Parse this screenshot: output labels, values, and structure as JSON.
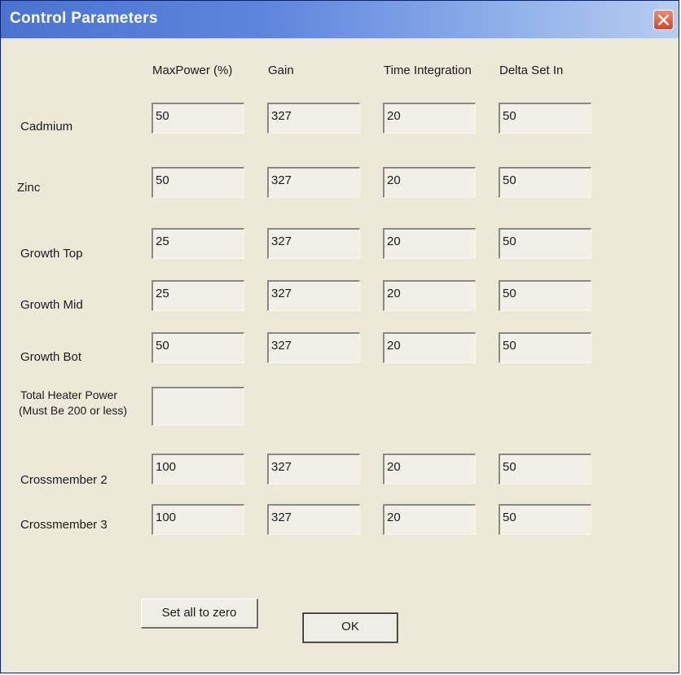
{
  "window": {
    "title": "Control Parameters"
  },
  "columns": [
    "MaxPower (%)",
    "Gain",
    "Time Integration",
    "Delta Set In"
  ],
  "rows": [
    {
      "label": "Cadmium",
      "values": [
        "50",
        "327",
        "20",
        "50"
      ]
    },
    {
      "label": "Zinc",
      "values": [
        "50",
        "327",
        "20",
        "50"
      ]
    },
    {
      "label": "Growth Top",
      "values": [
        "25",
        "327",
        "20",
        "50"
      ]
    },
    {
      "label": "Growth Mid",
      "values": [
        "25",
        "327",
        "20",
        "50"
      ]
    },
    {
      "label": "Growth Bot",
      "values": [
        "50",
        "327",
        "20",
        "50"
      ]
    }
  ],
  "total_heater": {
    "line1": "Total Heater Power",
    "line2": "(Must Be 200 or less)",
    "value": ""
  },
  "crossmembers": [
    {
      "label": "Crossmember 2",
      "values": [
        "100",
        "327",
        "20",
        "50"
      ]
    },
    {
      "label": "Crossmember 3",
      "values": [
        "100",
        "327",
        "20",
        "50"
      ]
    }
  ],
  "buttons": {
    "zero": "Set all to zero",
    "ok": "OK"
  }
}
